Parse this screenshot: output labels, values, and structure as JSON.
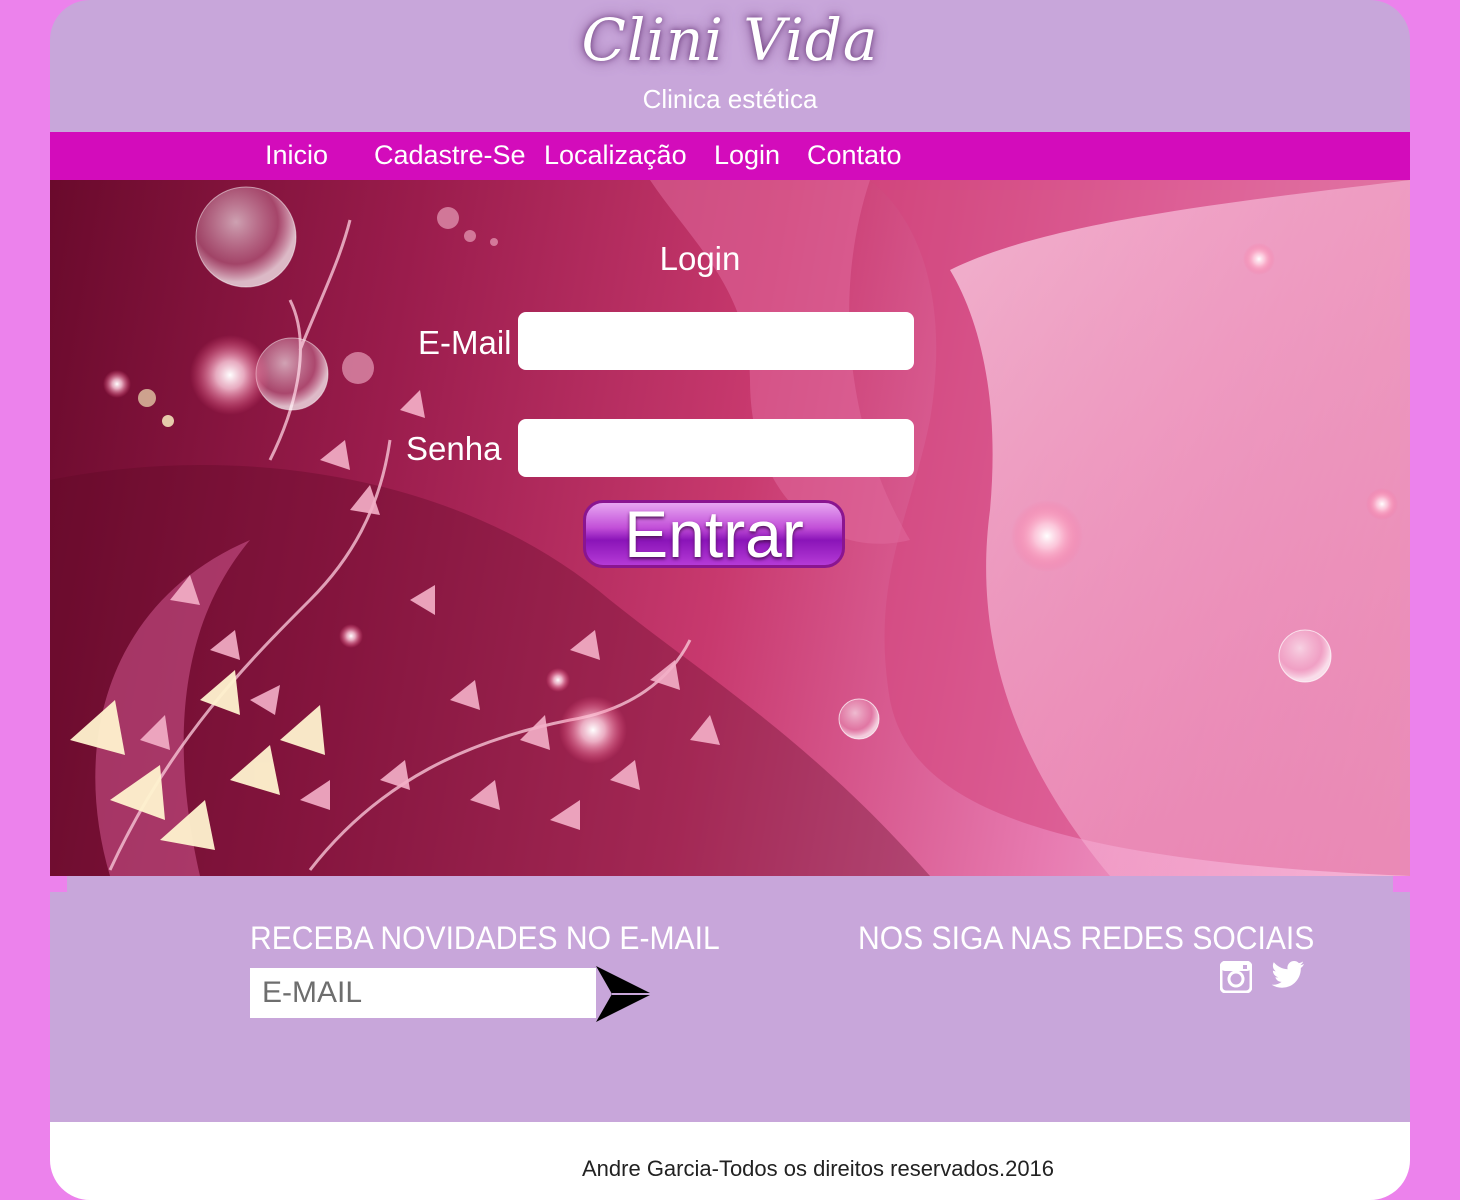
{
  "header": {
    "logo": "Clini Vida",
    "tagline": "Clinica estética"
  },
  "nav": {
    "items": [
      "Inicio",
      "Cadastre-Se",
      "Localização",
      "Login",
      "Contato"
    ]
  },
  "login": {
    "title": "Login",
    "email_label": "E-Mail",
    "email_value": "",
    "password_label": "Senha",
    "password_value": "",
    "submit_label": "Entrar"
  },
  "newsletter": {
    "title": "RECEBA NOVIDADES NO E-MAIL",
    "placeholder": "E-MAIL",
    "send_icon": "arrow-right-icon"
  },
  "social": {
    "title": "NOS SIGA NAS REDES SOCIAIS",
    "icons": [
      "instagram-icon",
      "twitter-icon"
    ]
  },
  "footer": {
    "copyright": "Andre Garcia-Todos os direitos reservados.2016"
  },
  "colors": {
    "page_bg": "#ec82ec",
    "header_bg": "#c8a6da",
    "nav_bg": "#d30cbb",
    "button_purple": "#8a14b8"
  }
}
